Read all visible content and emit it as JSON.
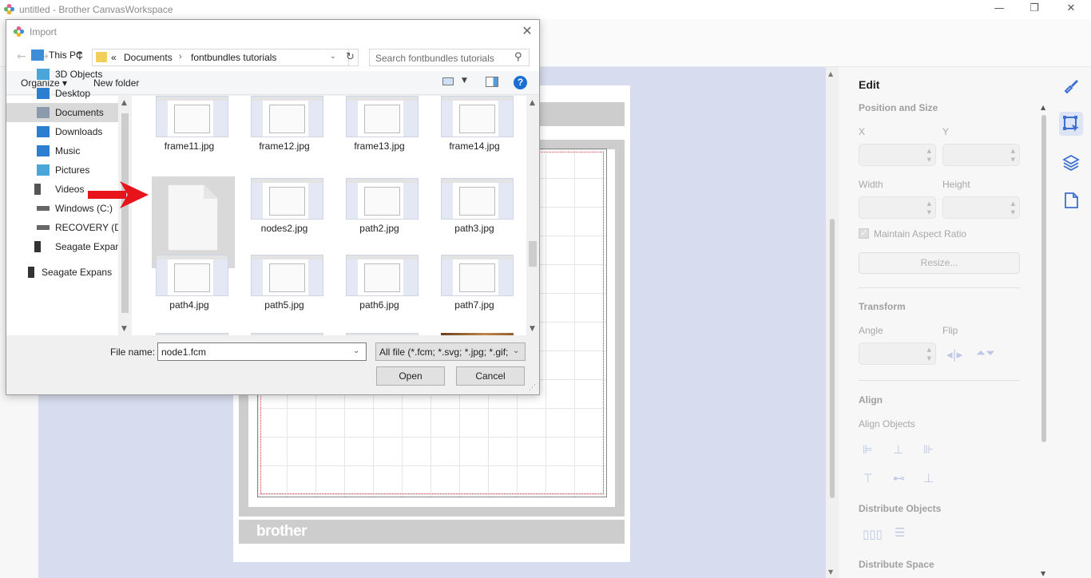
{
  "app": {
    "title": "untitled - Brother CanvasWorkspace",
    "window_buttons": {
      "minimize": "—",
      "restore": "❐",
      "close": "✕"
    },
    "accent_color": "#3c6fd1"
  },
  "canvas": {
    "logo_text": "brother"
  },
  "edit_panel": {
    "title": "Edit",
    "position_size": {
      "title": "Position and Size",
      "x_label": "X",
      "y_label": "Y",
      "width_label": "Width",
      "height_label": "Height",
      "maintain_label": "Maintain Aspect Ratio",
      "maintain_checked": true,
      "resize_label": "Resize..."
    },
    "transform": {
      "title": "Transform",
      "angle_label": "Angle",
      "flip_label": "Flip"
    },
    "align": {
      "title": "Align",
      "align_objects_label": "Align Objects",
      "distribute_objects_label": "Distribute Objects",
      "distribute_space_label": "Distribute Space"
    }
  },
  "icon_strip": [
    {
      "name": "paint-brush-icon"
    },
    {
      "name": "select-edit-icon",
      "active": true
    },
    {
      "name": "layers-icon"
    },
    {
      "name": "page-icon"
    }
  ],
  "dialog": {
    "title": "Import",
    "close": "✕",
    "nav": {
      "back": "←",
      "forward": "→",
      "recent": "⌄",
      "up": "↑"
    },
    "address": {
      "sep": "«",
      "crumbs": [
        "Documents",
        "fontbundles tutorials"
      ],
      "arrow": "›",
      "refresh": "↻"
    },
    "search_placeholder": "Search fontbundles tutorials",
    "commands": {
      "organize": "Organize ▾",
      "new_folder": "New folder",
      "help": "?"
    },
    "nav_pane": [
      {
        "label": "This PC",
        "icon": "computer-icon",
        "selected": false
      },
      {
        "label": "3D Objects",
        "icon": "cube-icon",
        "selected": false
      },
      {
        "label": "Desktop",
        "icon": "desktop-icon",
        "selected": false
      },
      {
        "label": "Documents",
        "icon": "documents-icon",
        "selected": true
      },
      {
        "label": "Downloads",
        "icon": "download-icon",
        "selected": false
      },
      {
        "label": "Music",
        "icon": "music-icon",
        "selected": false
      },
      {
        "label": "Pictures",
        "icon": "pictures-icon",
        "selected": false
      },
      {
        "label": "Videos",
        "icon": "videos-icon",
        "selected": false
      },
      {
        "label": "Windows (C:)",
        "icon": "drive-icon",
        "selected": false
      },
      {
        "label": "RECOVERY (D:)",
        "icon": "drive-icon",
        "selected": false
      },
      {
        "label": "Seagate Expansion",
        "icon": "external-drive-icon",
        "selected": false
      },
      {
        "label": "Seagate Expansion",
        "icon": "external-drive-icon",
        "selected": false
      }
    ],
    "files": [
      {
        "name": "frame11.jpg",
        "kind": "thumb"
      },
      {
        "name": "frame12.jpg",
        "kind": "thumb"
      },
      {
        "name": "frame13.jpg",
        "kind": "thumb"
      },
      {
        "name": "frame14.jpg",
        "kind": "thumb"
      },
      {
        "name": "node1.fcm",
        "kind": "doc",
        "selected": true
      },
      {
        "name": "nodes2.jpg",
        "kind": "thumb"
      },
      {
        "name": "path2.jpg",
        "kind": "thumb"
      },
      {
        "name": "path3.jpg",
        "kind": "thumb"
      },
      {
        "name": "path4.jpg",
        "kind": "thumb"
      },
      {
        "name": "path5.jpg",
        "kind": "thumb"
      },
      {
        "name": "path6.jpg",
        "kind": "thumb"
      },
      {
        "name": "path7.jpg",
        "kind": "thumb"
      },
      {
        "name": "",
        "kind": "thumb"
      },
      {
        "name": "",
        "kind": "thumb"
      },
      {
        "name": "",
        "kind": "thumb"
      },
      {
        "name": "",
        "kind": "photo"
      }
    ],
    "file_name_label": "File name:",
    "file_name_value": "node1.fcm",
    "file_type_value": "All file (*.fcm; *.svg; *.jpg; *.gif;",
    "open_label": "Open",
    "cancel_label": "Cancel",
    "annotation_color": "#e8141b"
  }
}
